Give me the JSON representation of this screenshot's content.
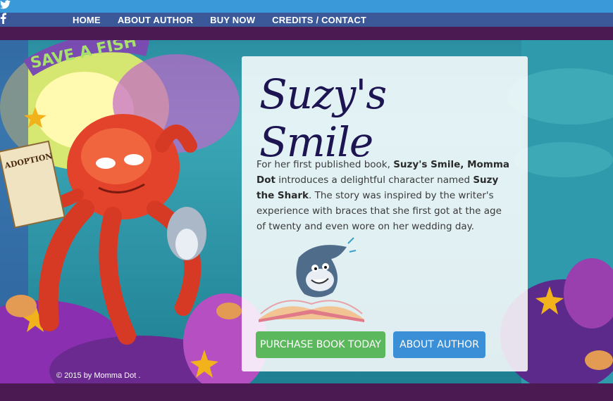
{
  "nav": {
    "items": [
      "HOME",
      "ABOUT AUTHOR",
      "BUY NOW",
      "CREDITS / CONTACT"
    ]
  },
  "social": {
    "twitter_icon": "twitter-icon",
    "facebook_icon": "facebook-icon"
  },
  "scene": {
    "sign_text": "SAVE A FISH",
    "scroll_text": "ADOPTION"
  },
  "content": {
    "title": "Suzy's Smile",
    "paragraph": {
      "t1": "For her first published book, ",
      "b1": "Suzy's Smile, Momma Dot",
      "t2": " introduces a delightful character named ",
      "b2": "Suzy the Shark",
      "t3": ". The story was inspired by the writer's experience with braces that she first got at the age of twenty and even wore on her wedding day."
    },
    "buttons": {
      "purchase": "PURCHASE BOOK TODAY",
      "author": "ABOUT AUTHOR"
    }
  },
  "footer": {
    "text": "© 2015 by Momma Dot ."
  },
  "colors": {
    "topbar": "#4b1a52",
    "title": "#1d1552",
    "purchase_button": "#5cb85c",
    "author_button": "#3a8fd6"
  }
}
